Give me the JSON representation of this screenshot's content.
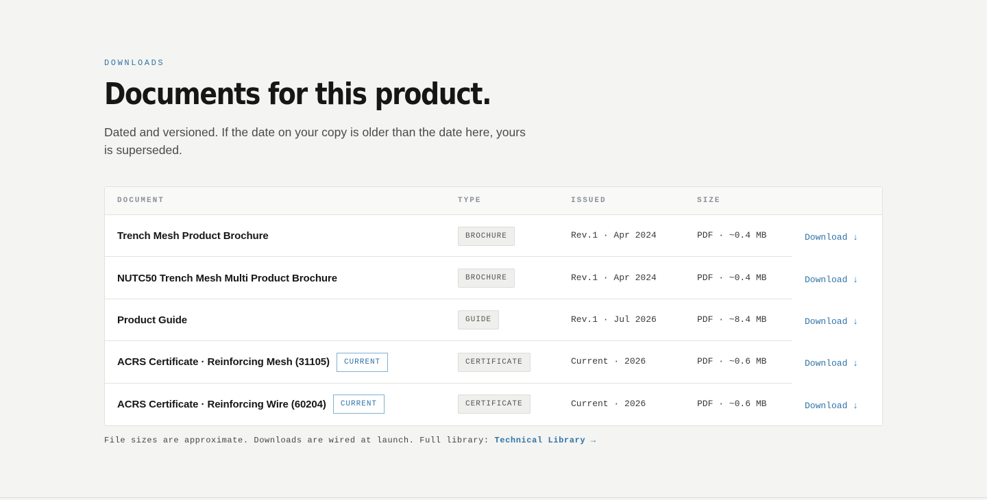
{
  "section": {
    "eyebrow": "DOWNLOADS",
    "title": "Documents for this product.",
    "lede": "Dated and versioned. If the date on your copy is older than the date here, yours is superseded."
  },
  "table": {
    "headers": {
      "document": "DOCUMENT",
      "type": "TYPE",
      "issued": "ISSUED",
      "size": "SIZE"
    },
    "rows": [
      {
        "name": "Trench Mesh Product Brochure",
        "badge": "",
        "type": "BROCHURE",
        "issued": "Rev.1 · Apr 2024",
        "size": "PDF · ~0.4 MB",
        "action": "Download ↓"
      },
      {
        "name": "NUTC50 Trench Mesh Multi Product Brochure",
        "badge": "",
        "type": "BROCHURE",
        "issued": "Rev.1 · Apr 2024",
        "size": "PDF · ~0.4 MB",
        "action": "Download ↓"
      },
      {
        "name": "Product Guide",
        "badge": "",
        "type": "GUIDE",
        "issued": "Rev.1 · Jul 2026",
        "size": "PDF · ~8.4 MB",
        "action": "Download ↓"
      },
      {
        "name": "ACRS Certificate · Reinforcing Mesh (31105)",
        "badge": "CURRENT",
        "type": "CERTIFICATE",
        "issued": "Current · 2026",
        "size": "PDF · ~0.6 MB",
        "action": "Download ↓"
      },
      {
        "name": "ACRS Certificate · Reinforcing Wire (60204)",
        "badge": "CURRENT",
        "type": "CERTIFICATE",
        "issued": "Current · 2026",
        "size": "PDF · ~0.6 MB",
        "action": "Download ↓"
      }
    ]
  },
  "footnote": {
    "text": "File sizes are approximate. Downloads are wired at launch. Full library: ",
    "link": "Technical Library →"
  },
  "colors": {
    "accent": "#2f74a8",
    "background": "#f4f4f2"
  }
}
